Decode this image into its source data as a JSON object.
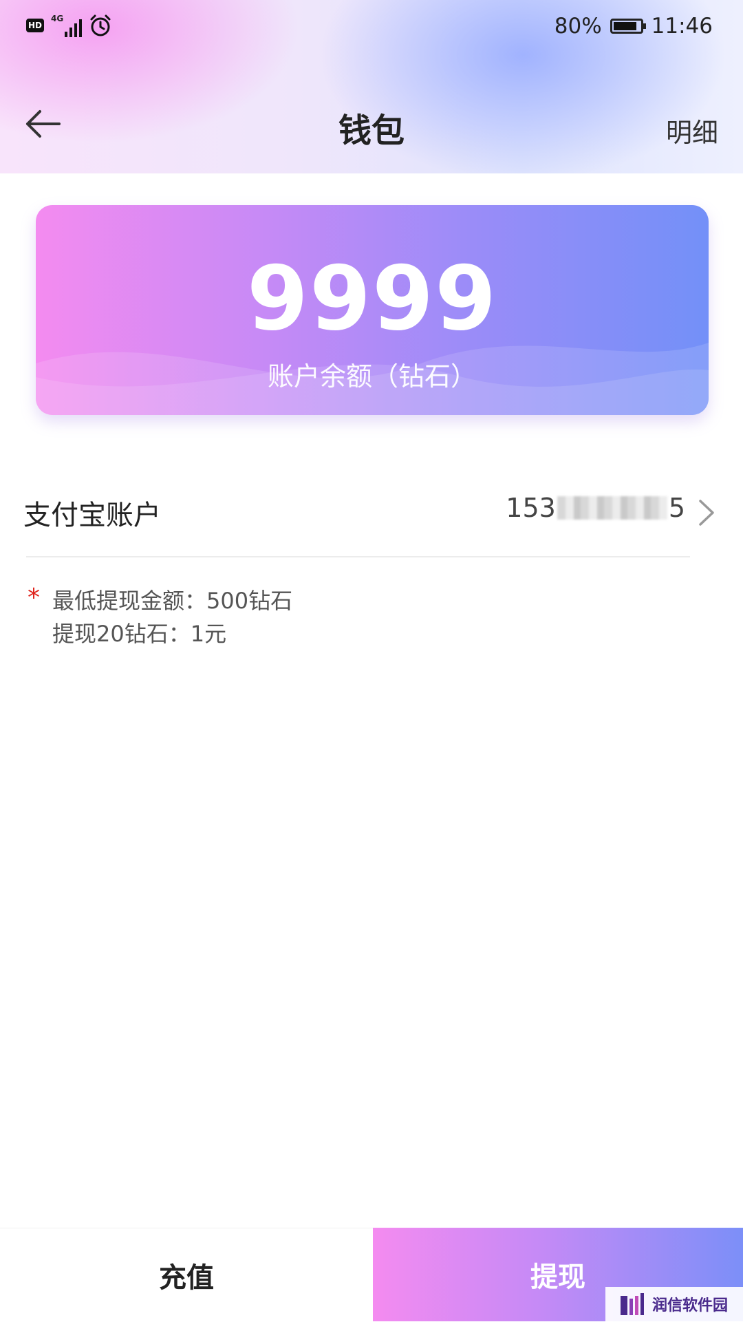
{
  "status_bar": {
    "network_label": "4G",
    "battery_percent": "80%",
    "battery_level": 0.8,
    "time": "11:46",
    "icons": [
      "hd-icon",
      "signal-icon",
      "alarm-icon",
      "battery-icon"
    ]
  },
  "nav": {
    "back_icon": "arrow-left-icon",
    "title": "钱包",
    "detail_label": "明细"
  },
  "balance_card": {
    "amount": "9999",
    "caption": "账户余额（钻石）"
  },
  "alipay": {
    "label": "支付宝账户",
    "value_prefix": "153",
    "value_suffix": "5",
    "chevron_icon": "chevron-right-icon"
  },
  "notes": {
    "marker": "*",
    "line1": "最低提现金额：500钻石",
    "line2": "提现20钻石：1元"
  },
  "actions": {
    "recharge_label": "充值",
    "withdraw_label": "提现"
  },
  "watermark": {
    "text": "润信软件园"
  },
  "colors": {
    "accent_start": "#f48bf0",
    "accent_end": "#7390f8",
    "note_marker": "#e0251e"
  }
}
